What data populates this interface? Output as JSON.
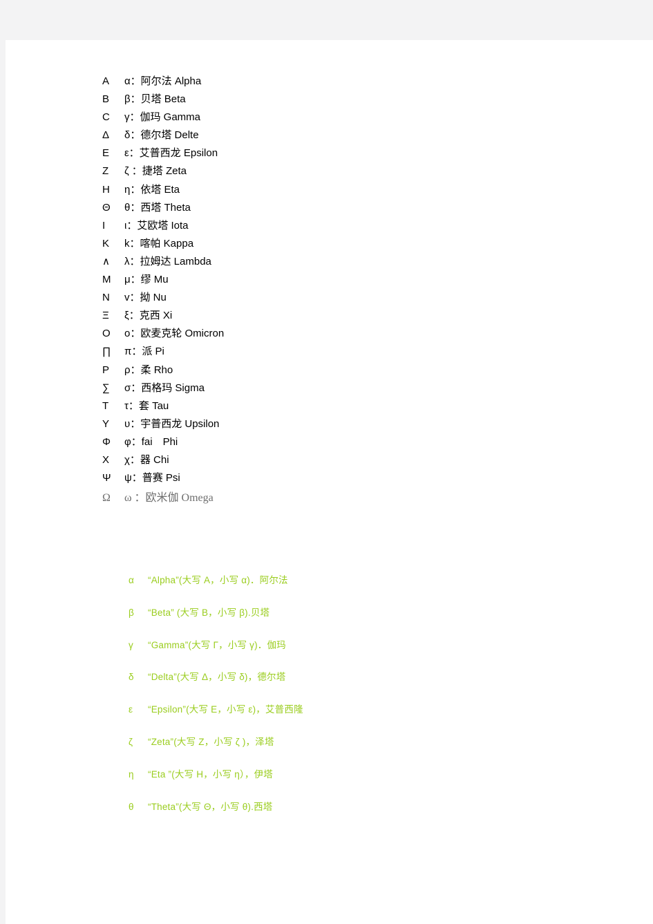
{
  "document": {
    "page_background": "#ffffff",
    "gutter_color": "#f3f3f4",
    "section1_color": "#000000",
    "section1_last_row_color": "#6f6f6f",
    "section2_color": "#9acd1e"
  },
  "alphabet_list": [
    {
      "upper": "A",
      "desc": "α：阿尔法 Alpha"
    },
    {
      "upper": "B",
      "desc": "β：贝塔 Beta"
    },
    {
      "upper": "C",
      "desc": "γ：伽玛 Gamma"
    },
    {
      "upper": "Δ",
      "desc": "δ：德尔塔 Delte"
    },
    {
      "upper": "E",
      "desc": "ε：艾普西龙 Epsilon"
    },
    {
      "upper": "Z",
      "desc": "ζ ：捷塔 Zeta"
    },
    {
      "upper": "H",
      "desc": "η：依塔 Eta"
    },
    {
      "upper": "Θ",
      "desc": "θ：西塔 Theta"
    },
    {
      "upper": "I",
      "desc": "ι：艾欧塔 Iota"
    },
    {
      "upper": "K",
      "desc": "k：喀帕 Kappa"
    },
    {
      "upper": "∧",
      "desc": "λ：拉姆达 Lambda"
    },
    {
      "upper": "M",
      "desc": "μ：缪 Mu"
    },
    {
      "upper": "N",
      "desc": "v：拗 Nu"
    },
    {
      "upper": "Ξ",
      "desc": "ξ：克西 Xi"
    },
    {
      "upper": "O",
      "desc": "o：欧麦克轮 Omicron"
    },
    {
      "upper": "∏",
      "desc": "π：派 Pi"
    },
    {
      "upper": "P",
      "desc": "ρ：柔 Rho"
    },
    {
      "upper": "∑",
      "desc": "σ：西格玛 Sigma"
    },
    {
      "upper": "T",
      "desc": "τ：套 Tau"
    },
    {
      "upper": "Y",
      "desc": "υ：宇普西龙 Upsilon"
    },
    {
      "upper": "Φ",
      "desc": "φ：fai　Phi"
    },
    {
      "upper": "X",
      "desc": "χ：器 Chi"
    },
    {
      "upper": "Ψ",
      "desc": "ψ：普赛 Psi"
    },
    {
      "upper": "Ω",
      "desc": "ω ：欧米伽 Omega"
    }
  ],
  "green_list": [
    {
      "letter": "α",
      "desc": "“Alpha”(大写 A，小写 α)．阿尔法"
    },
    {
      "letter": "β",
      "desc": "“Beta” (大写 B，小写 β).贝塔"
    },
    {
      "letter": "γ",
      "desc": "“Gamma”(大写 Γ，小写 γ)．伽玛"
    },
    {
      "letter": "δ",
      "desc": "“Delta”(大写 Δ，小写 δ)，德尔塔"
    },
    {
      "letter": "ε",
      "desc": "“Epsilon”(大写 E，小写 ε)，艾普西隆"
    },
    {
      "letter": "ζ",
      "desc": "“Zeta”(大写 Z，小写 ζ )，泽塔"
    },
    {
      "letter": "η",
      "desc": "“Eta ”(大写 H，小写 η），伊塔"
    },
    {
      "letter": "θ",
      "desc": "“Theta”(大写 Θ，小写 θ).西塔"
    }
  ]
}
